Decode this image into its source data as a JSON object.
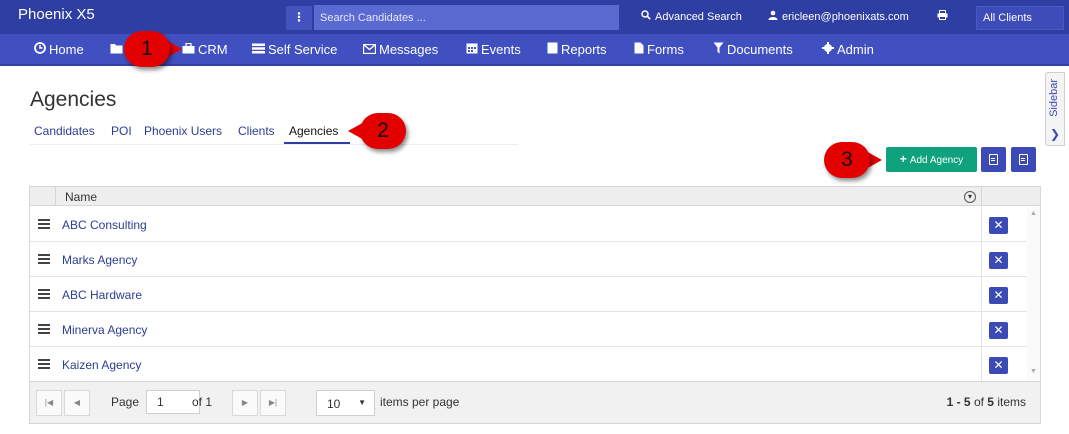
{
  "app": {
    "title": "Phoenix X5"
  },
  "search": {
    "menu_glyph": "⋮",
    "placeholder": "Search Candidates ..."
  },
  "topbar": {
    "advanced_search": "Advanced Search",
    "user_email": "ericleen@phoenixats.com",
    "client_filter": "All Clients"
  },
  "menu": {
    "items": [
      {
        "label": "Home",
        "icon": "clock-icon"
      },
      {
        "label": "",
        "icon": "folder-icon"
      },
      {
        "label": "CRM",
        "icon": "briefcase-icon"
      },
      {
        "label": "Self Service",
        "icon": "list-icon"
      },
      {
        "label": "Messages",
        "icon": "envelope-icon"
      },
      {
        "label": "Events",
        "icon": "calendar-icon"
      },
      {
        "label": "Reports",
        "icon": "report-icon"
      },
      {
        "label": "Forms",
        "icon": "file-icon"
      },
      {
        "label": "Documents",
        "icon": "funnel-icon"
      },
      {
        "label": "Admin",
        "icon": "gear-icon"
      }
    ]
  },
  "sidebar": {
    "label": "Sidebar"
  },
  "page": {
    "title": "Agencies"
  },
  "subnav": {
    "items": [
      {
        "label": "Candidates"
      },
      {
        "label": "POI"
      },
      {
        "label": "Phoenix Users"
      },
      {
        "label": "Clients"
      },
      {
        "label": "Agencies",
        "active": true
      }
    ]
  },
  "actions": {
    "add_label": "Add Agency",
    "add_glyph": "+"
  },
  "grid": {
    "columns": [
      "Name"
    ],
    "rows": [
      {
        "name": "ABC Consulting"
      },
      {
        "name": "Marks Agency"
      },
      {
        "name": "ABC Hardware"
      },
      {
        "name": "Minerva Agency"
      },
      {
        "name": "Kaizen Agency"
      }
    ],
    "delete_glyph": "✕"
  },
  "pager": {
    "page_label": "Page",
    "current_page": "1",
    "of_label": "of 1",
    "page_size": "10",
    "items_per_page_label": "items per page",
    "range": "1 - 5",
    "of_text": " of ",
    "total": "5",
    "items_label": " items"
  },
  "callouts": [
    "1",
    "2",
    "3"
  ],
  "colors": {
    "topbar": "#2f3ea3",
    "menubar": "#4150c0",
    "accent_green": "#0fa27d",
    "callout_red": "#e30000"
  }
}
